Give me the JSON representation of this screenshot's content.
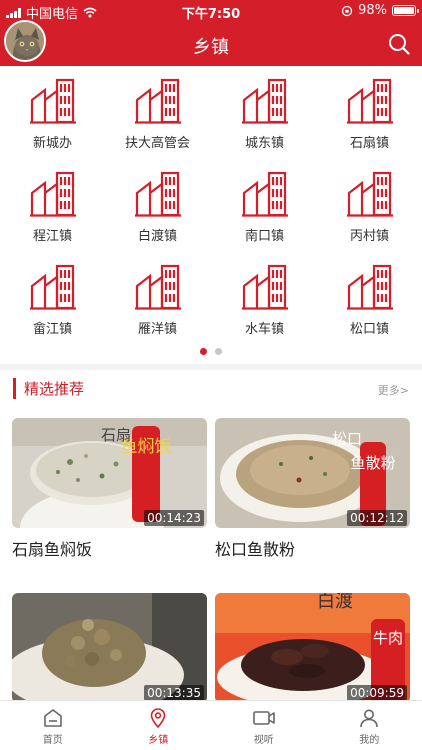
{
  "status_bar": {
    "carrier": "中国电信",
    "time": "下午7:50",
    "battery": "98%",
    "battery_level": 0.98
  },
  "header": {
    "title": "乡镇"
  },
  "towns": [
    {
      "label": "新城办"
    },
    {
      "label": "扶大高管会"
    },
    {
      "label": "城东镇"
    },
    {
      "label": "石扇镇"
    },
    {
      "label": "程江镇"
    },
    {
      "label": "白渡镇"
    },
    {
      "label": "南口镇"
    },
    {
      "label": "丙村镇"
    },
    {
      "label": "畲江镇"
    },
    {
      "label": "雁洋镇"
    },
    {
      "label": "水车镇"
    },
    {
      "label": "松口镇"
    }
  ],
  "pager": {
    "count": 2,
    "active": 0
  },
  "featured": {
    "title": "精选推荐",
    "more": "更多>",
    "items": [
      {
        "title": "石扇鱼焖饭",
        "duration": "00:14:23",
        "overlay_caption": "鱼焖饭",
        "overlay_side": "石扇"
      },
      {
        "title": "松口鱼散粉",
        "duration": "00:12:12",
        "overlay_caption": "鱼散粉",
        "overlay_side": "松口"
      },
      {
        "title": "",
        "duration": "00:13:35",
        "overlay_caption": "",
        "overlay_side": ""
      },
      {
        "title": "",
        "duration": "00:09:59",
        "overlay_caption": "牛肉",
        "overlay_side": "白渡"
      }
    ]
  },
  "tabbar": [
    {
      "label": "首页",
      "icon": "home-icon"
    },
    {
      "label": "乡镇",
      "icon": "location-pin-icon"
    },
    {
      "label": "视听",
      "icon": "video-camera-icon"
    },
    {
      "label": "我的",
      "icon": "user-icon"
    }
  ],
  "colors": {
    "brand": "#d41e2a",
    "inactive": "#666666"
  }
}
